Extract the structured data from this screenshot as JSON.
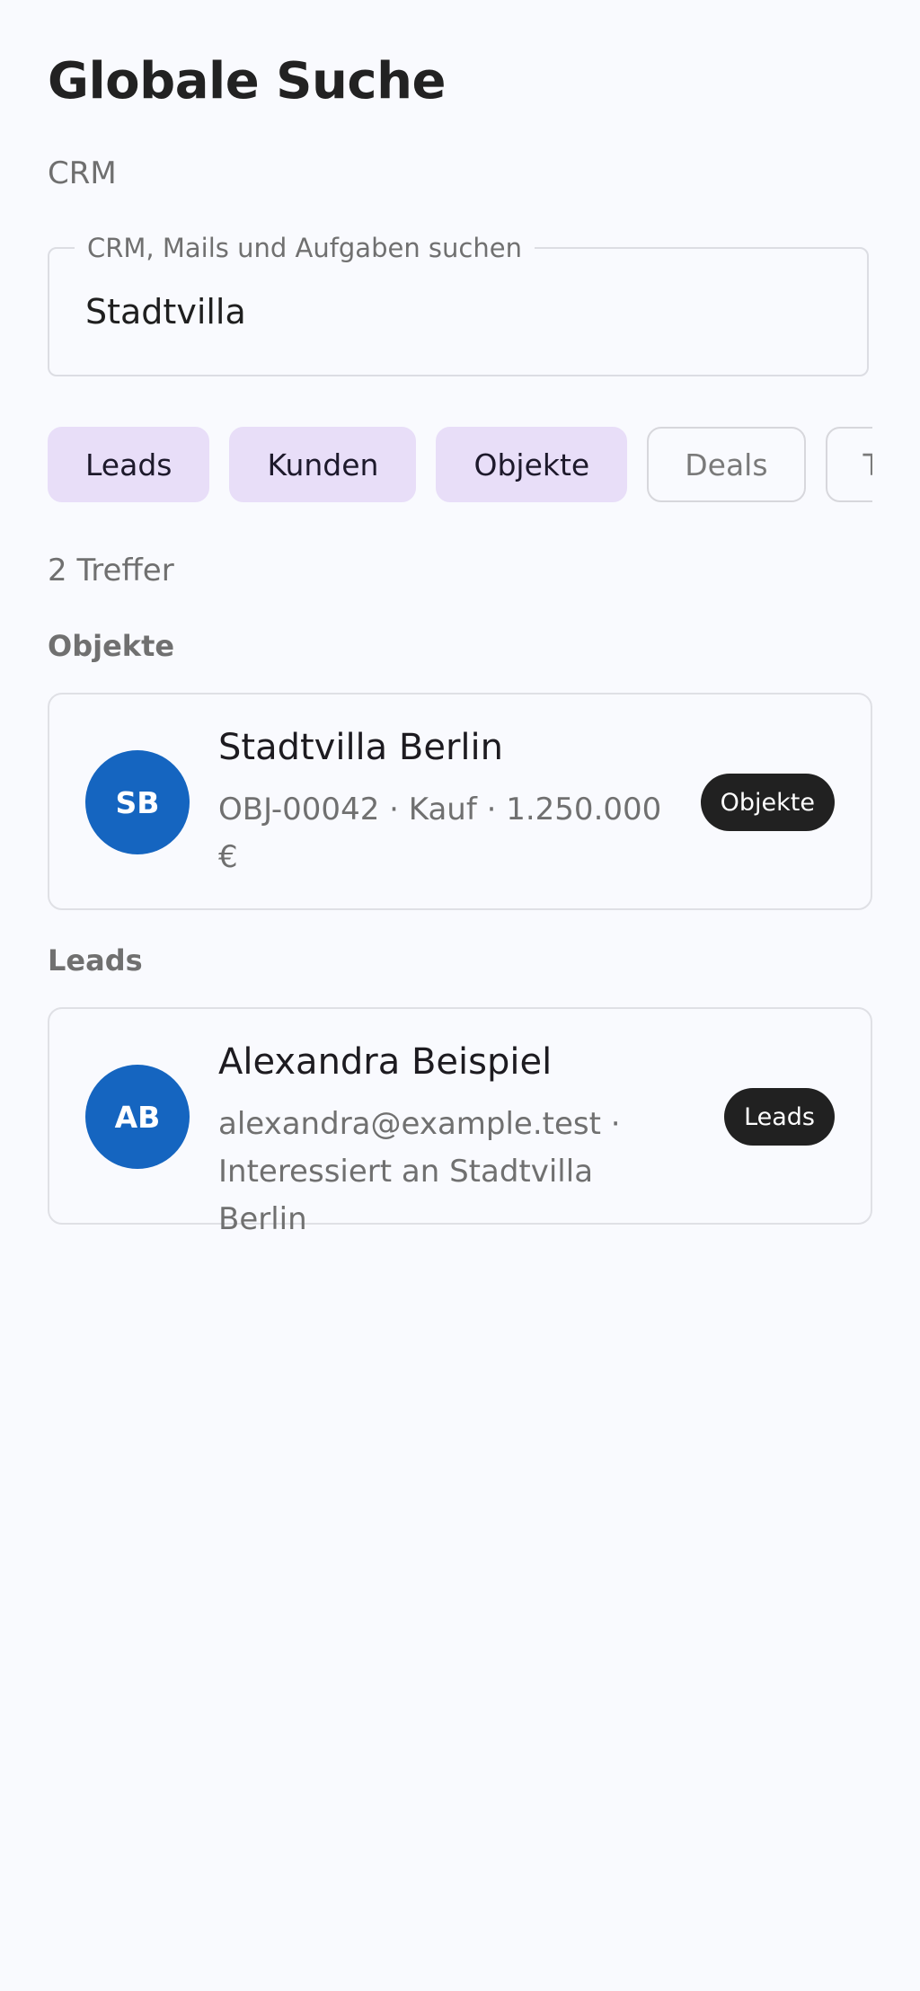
{
  "header": {
    "title": "Globale Suche",
    "subtitle": "CRM"
  },
  "search": {
    "label": "CRM, Mails und Aufgaben suchen",
    "value": "Stadtvilla"
  },
  "filters": [
    {
      "label": "Leads",
      "selected": true
    },
    {
      "label": "Kunden",
      "selected": true
    },
    {
      "label": "Objekte",
      "selected": true
    },
    {
      "label": "Deals",
      "selected": false
    },
    {
      "label": "T",
      "selected": false
    }
  ],
  "results": {
    "count_text": "2 Treffer",
    "sections": [
      {
        "heading": "Objekte",
        "items": [
          {
            "initials": "SB",
            "title": "Stadtvilla Berlin",
            "subtitle": "OBJ-00042 · Kauf · 1.250.000 €",
            "badge": "Objekte"
          }
        ]
      },
      {
        "heading": "Leads",
        "items": [
          {
            "initials": "AB",
            "title": "Alexandra Beispiel",
            "subtitle": "alexandra@example.test · Interessiert an Stadtvilla Berlin",
            "badge": "Leads"
          }
        ]
      }
    ]
  },
  "colors": {
    "background": "#f9fafe",
    "chip_selected": "#e8def8",
    "avatar": "#1565c0",
    "badge": "#212121"
  }
}
